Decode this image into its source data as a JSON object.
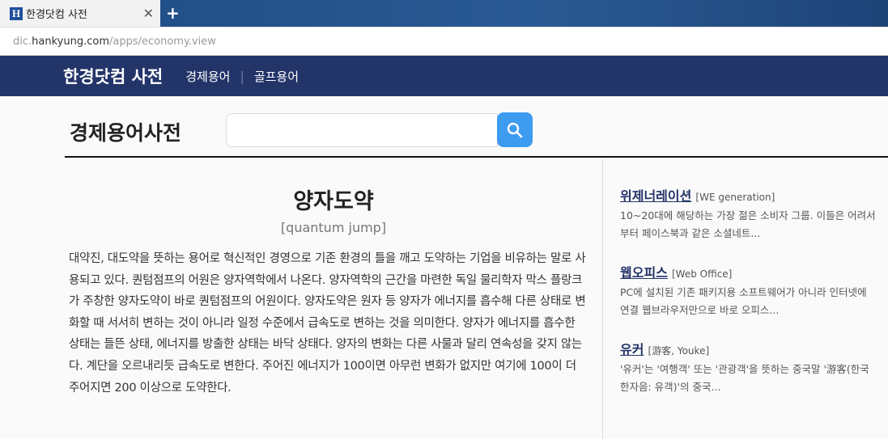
{
  "browser": {
    "tab_title": "한경닷컴 사전",
    "favicon": "H",
    "url_prefix": "dic.",
    "url_domain": "hankyung.com",
    "url_path": "/apps/economy.view"
  },
  "nav": {
    "logo": "한경닷컴 사전",
    "links": [
      "경제용어",
      "골프용어"
    ],
    "separator": "|"
  },
  "search": {
    "title": "경제용어사전",
    "placeholder": ""
  },
  "article": {
    "term": "양자도약",
    "english": "[quantum jump]",
    "description": "대약진, 대도약을 뜻하는 용어로 혁신적인 경영으로 기존 환경의 틀을 깨고 도약하는 기업을 비유하는 말로 사용되고 있다. 퀀텀점프의 어원은 양자역학에서 나온다. 양자역학의 근간을 마련한 독일 물리학자 막스 플랑크가 주창한 양자도약이 바로 퀀텀점프의 어원이다. 양자도약은 원자 등 양자가 에너지를 흡수해 다른 상태로 변화할 때 서서히 변하는 것이 아니라 일정 수준에서 급속도로 변하는 것을 의미한다. 양자가 에너지를 흡수한 상태는 들뜬 상태, 에너지를 방출한 상태는 바닥 상태다. 양자의 변화는 다른 사물과 달리 연속성을 갖지 않는다. 계단을 오르내리듯 급속도로 변한다. 주어진 에너지가 100이면 아무런 변화가 없지만 여기에 100이 더 주어지면 200 이상으로 도약한다."
  },
  "related": [
    {
      "title": "위제너레이션",
      "english": "[WE generation]",
      "desc": "10~20대에 해당하는 가장 젊은 소비자 그룹. 이들은 어려서부터 페이스북과 같은 소셜네트..."
    },
    {
      "title": "웹오피스",
      "english": "[Web Office]",
      "desc": "PC에 설치된 기존 패키지용 소프트웨어가 아니라 인터넷에 연결 웹브라우저만으로 바로 오피스..."
    },
    {
      "title": "유커",
      "english": "[游客, Youke]",
      "desc": "'유커'는 '여행객' 또는 '관광객'을 뜻하는 중국말 '游客(한국 한자음: 유객)'의 중국..."
    }
  ]
}
